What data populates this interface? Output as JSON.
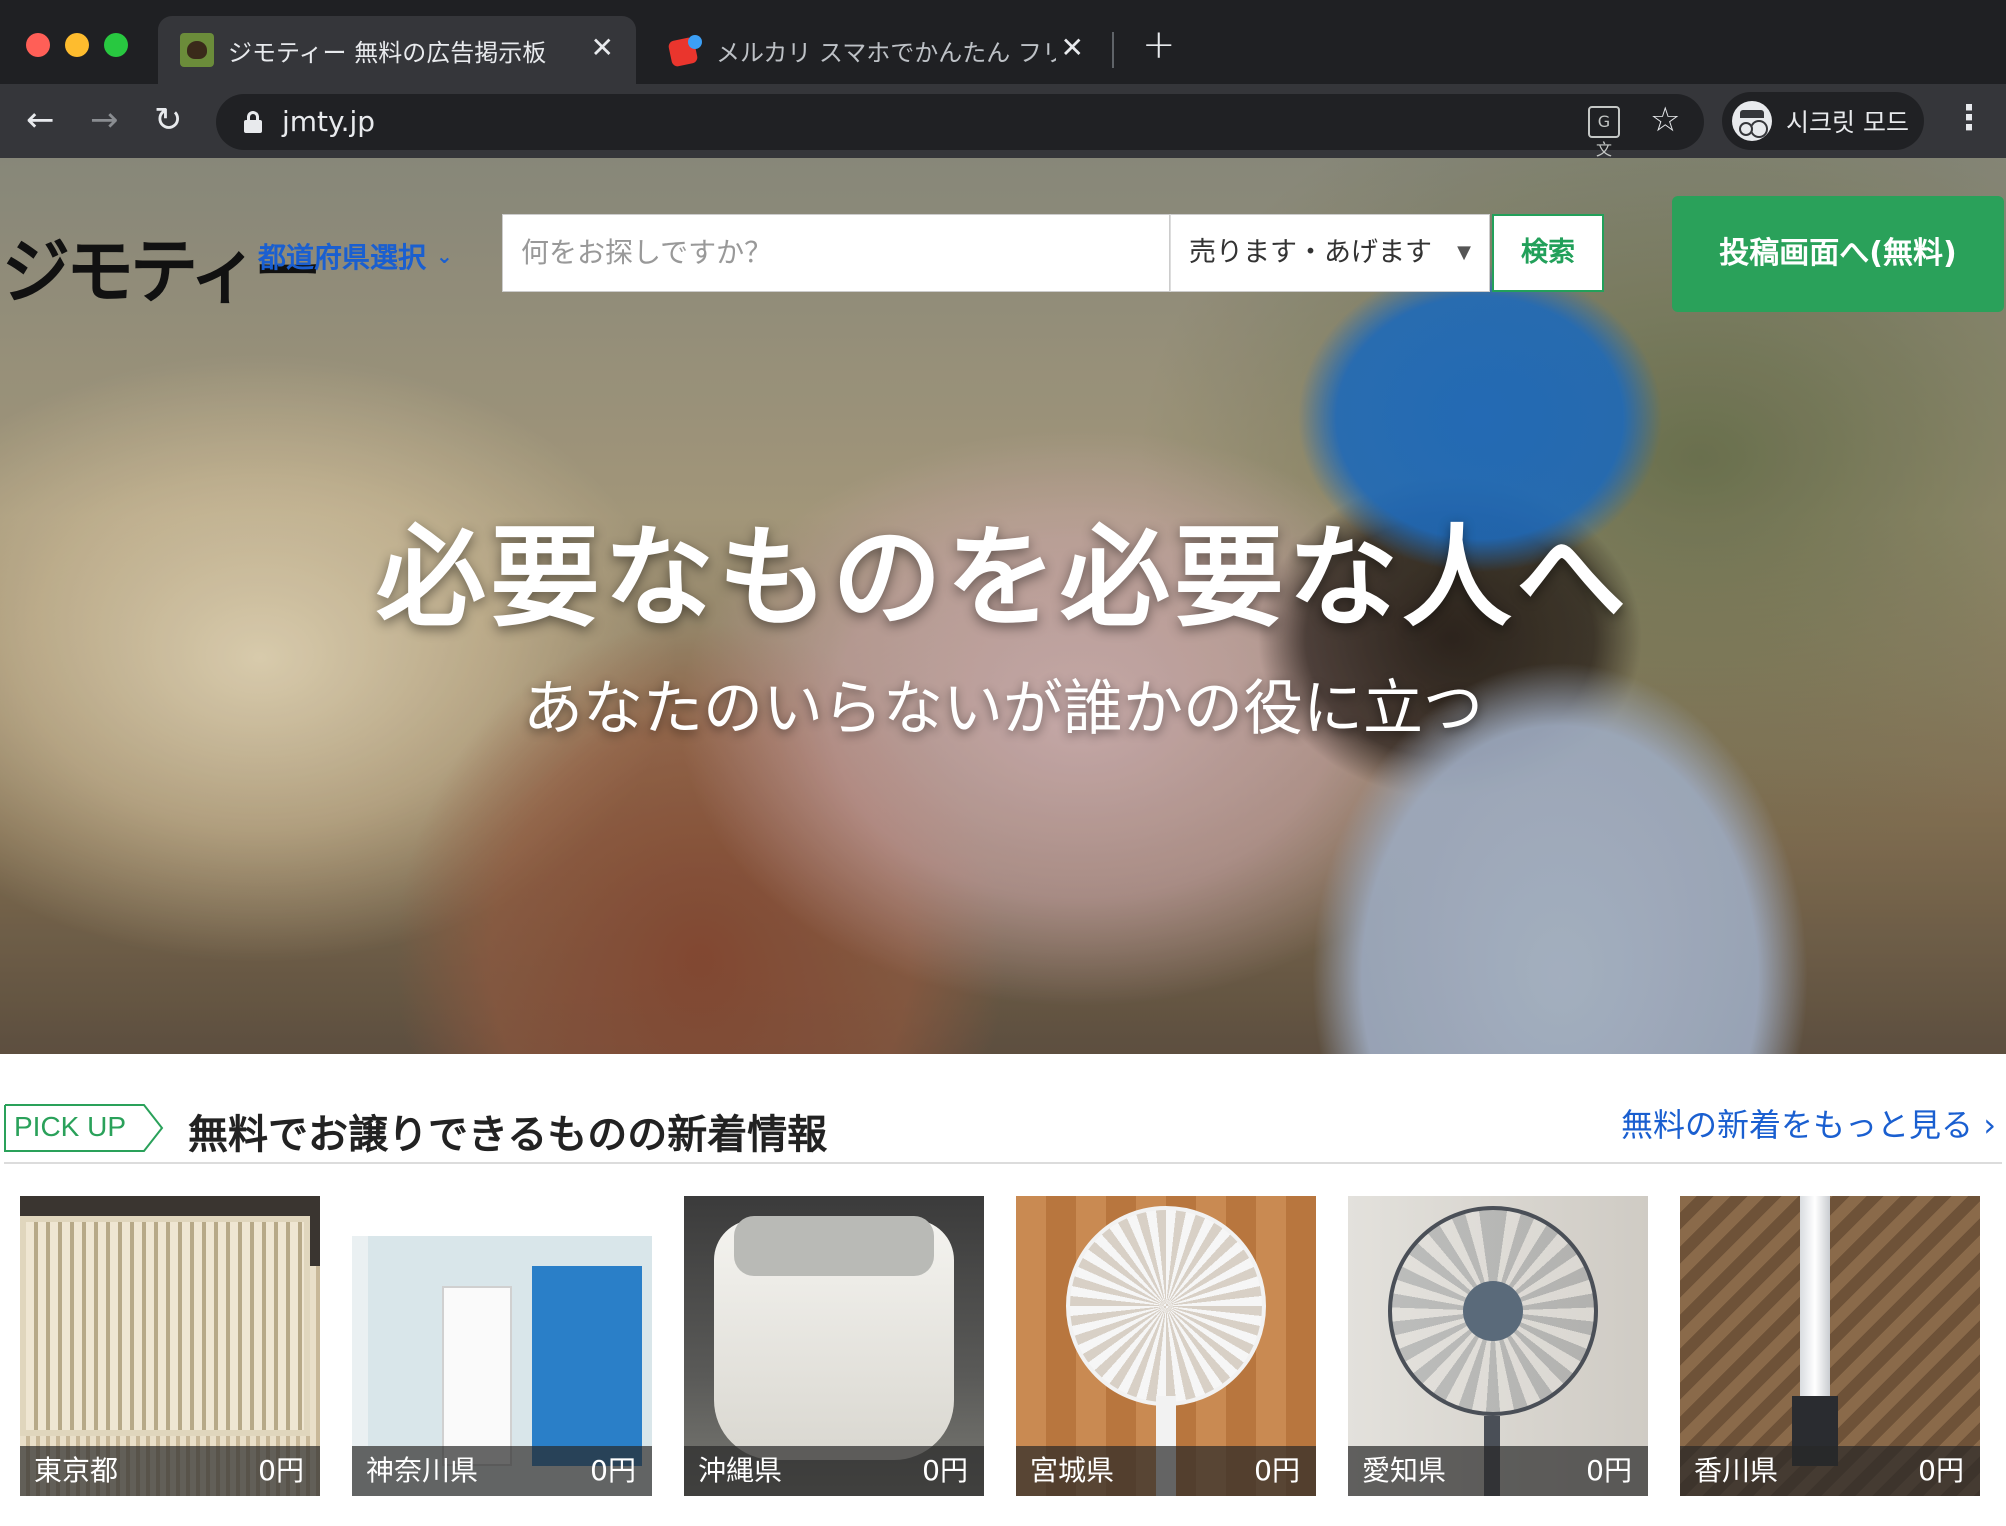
{
  "browser": {
    "tabs": [
      {
        "title": "ジモティー 無料の広告掲示板",
        "icon": "jmty-favicon",
        "active": true
      },
      {
        "title": "メルカリ スマホでかんたん フリマア",
        "icon": "mercari-favicon",
        "active": false
      }
    ],
    "url": "jmty.jp",
    "incognito_label": "시크릿 모드",
    "icons": {
      "back": "←",
      "forward": "→",
      "reload": "↻",
      "close": "✕",
      "new_tab": "+",
      "star": "☆",
      "menu": "⋮",
      "translate": "G文"
    }
  },
  "header": {
    "logo": "ジモティー",
    "prefecture_select": "都道府県選択",
    "search_placeholder": "何をお探しですか？",
    "category_select": "売ります・あげます",
    "search_button": "検索",
    "post_button": "投稿画面へ(無料)"
  },
  "hero": {
    "title": "必要なものを必要な人へ",
    "subtitle": "あなたのいらないが誰かの役に立つ"
  },
  "pickup": {
    "badge": "PICK UP",
    "title": "無料でお譲りできるものの新着情報",
    "more_link": "無料の新着をもっと見る",
    "items": [
      {
        "prefecture": "東京都",
        "price": "0円"
      },
      {
        "prefecture": "神奈川県",
        "price": "0円"
      },
      {
        "prefecture": "沖縄県",
        "price": "0円"
      },
      {
        "prefecture": "宮城県",
        "price": "0円"
      },
      {
        "prefecture": "愛知県",
        "price": "0円"
      },
      {
        "prefecture": "香川県",
        "price": "0円"
      }
    ]
  },
  "colors": {
    "brand_green": "#2aa15a",
    "link_blue": "#1a5fd0",
    "chrome_dark": "#1f2023",
    "chrome_toolbar": "#35363a"
  }
}
